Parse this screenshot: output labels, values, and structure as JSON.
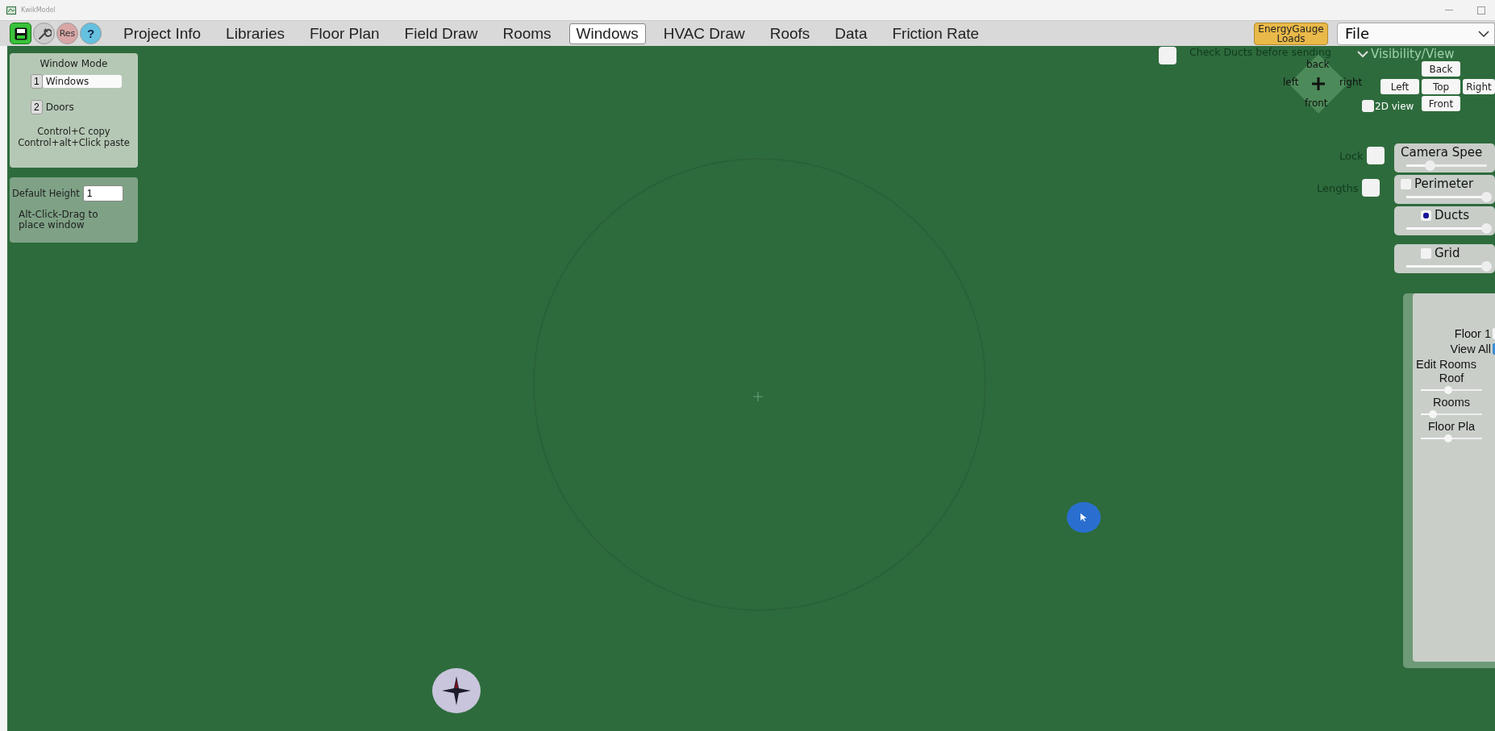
{
  "window": {
    "title": "KwikModel"
  },
  "toolbar": [
    {
      "kind": "save"
    },
    {
      "kind": "wrench"
    },
    {
      "kind": "badge",
      "label": "Res"
    },
    {
      "kind": "help",
      "label": "?"
    }
  ],
  "tabs": [
    {
      "label": "Project Info",
      "selected": false
    },
    {
      "label": "Libraries",
      "selected": false
    },
    {
      "label": "Floor Plan",
      "selected": false
    },
    {
      "label": "Field Draw",
      "selected": false
    },
    {
      "label": "Rooms",
      "selected": false
    },
    {
      "label": "Windows",
      "selected": true
    },
    {
      "label": "HVAC Draw",
      "selected": false
    },
    {
      "label": "Roofs",
      "selected": false
    },
    {
      "label": "Data",
      "selected": false
    },
    {
      "label": "Friction Rate",
      "selected": false
    }
  ],
  "loads_button": {
    "label": "EnergyGauge Loads"
  },
  "file_menu": {
    "value": "File"
  },
  "window_mode": {
    "title": "Window Mode",
    "options": [
      {
        "key": "1",
        "label": "Windows",
        "selected": true
      },
      {
        "key": "2",
        "label": "Doors",
        "selected": false
      }
    ],
    "hint": "Control+C copy Control+alt+Click paste"
  },
  "default_height": {
    "label": "Default Height",
    "value": "1",
    "hint": "Alt-Click-Drag to place window"
  },
  "check_ducts": {
    "label": "Check Ducts before sending",
    "checked": false
  },
  "visibility": {
    "label": "Visibility/View",
    "expanded": true
  },
  "navigator": {
    "back": "back",
    "left": "left",
    "right": "right",
    "front": "front"
  },
  "view_buttons": [
    "Back",
    "Left",
    "Top",
    "Right",
    "Front"
  ],
  "two_d_view": {
    "label": "2D view",
    "checked": false
  },
  "toggles": [
    {
      "label": "Lock",
      "checked": false
    },
    {
      "label": "Lengths",
      "checked": false
    }
  ],
  "layers": [
    {
      "label": "Camera Spee",
      "kind": "slider",
      "level": 0.3
    },
    {
      "label": "Perimeter",
      "kind": "checkbox",
      "checked": false,
      "level": 1
    },
    {
      "label": "Ducts",
      "kind": "radio",
      "selected": true,
      "level": 1
    },
    {
      "label": "Grid",
      "kind": "checkbox",
      "checked": false,
      "level": 1
    }
  ],
  "floor_panel": [
    {
      "label": "Floor 1",
      "kind": "checkbox",
      "checked": false
    },
    {
      "label": "View All",
      "kind": "checkbox",
      "checked": true
    },
    {
      "label": "Edit Rooms",
      "kind": "text"
    },
    {
      "label": "Roof",
      "kind": "slider",
      "level": 0.45
    },
    {
      "label": "Rooms",
      "kind": "slider",
      "level": 0.2
    },
    {
      "label": "Floor Pla",
      "kind": "slider",
      "level": 0.45
    }
  ]
}
